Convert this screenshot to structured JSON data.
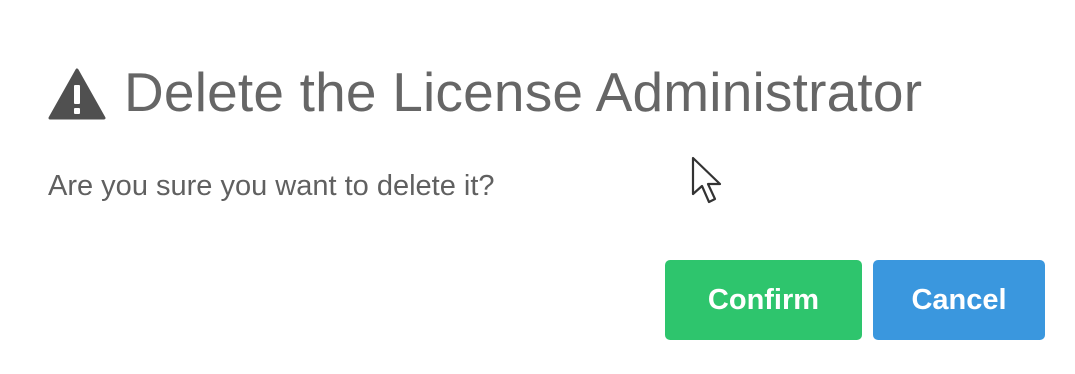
{
  "dialog": {
    "title": "Delete the License Administrator",
    "message": "Are you sure you want to delete it?",
    "confirm_label": "Confirm",
    "cancel_label": "Cancel",
    "title_icon": "warning-triangle-icon"
  },
  "colors": {
    "confirm_bg": "#2ec56d",
    "cancel_bg": "#3a97de",
    "title_text": "#666666",
    "message_text": "#606060",
    "icon": "#505050"
  }
}
